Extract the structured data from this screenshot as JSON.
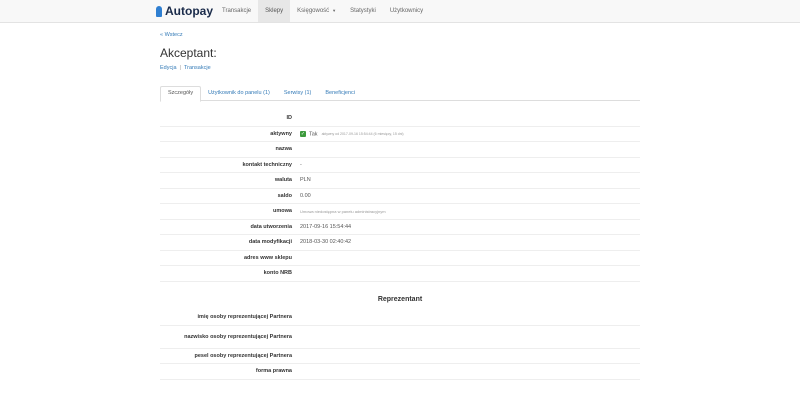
{
  "navbar": {
    "brand": "Autopay",
    "items": [
      {
        "label": "Transakcje"
      },
      {
        "label": "Sklepy"
      },
      {
        "label": "Księgowość"
      },
      {
        "label": "Statystyki"
      },
      {
        "label": "Użytkownicy"
      }
    ]
  },
  "back_link": "« Wstecz",
  "page_title": "Akceptant:",
  "sublinks": {
    "edit": "Edycja",
    "transactions": "Transakcje"
  },
  "tabs": [
    {
      "label": "Szczegóły"
    },
    {
      "label": "Użytkownik do panelu (1)"
    },
    {
      "label": "Serwisy (1)"
    },
    {
      "label": "Beneficjenci"
    }
  ],
  "details": {
    "id": {
      "label": "ID",
      "value": ""
    },
    "active": {
      "label": "aktywny",
      "value": "Tak",
      "since": "aktywny od 2017-09-16 15:54:44 (6 miesięcy, 15 dni)"
    },
    "name": {
      "label": "nazwa",
      "value": ""
    },
    "tech_contact": {
      "label": "kontakt techniczny",
      "value": "-"
    },
    "currency": {
      "label": "waluta",
      "value": "PLN"
    },
    "balance": {
      "label": "saldo",
      "value": "0.00"
    },
    "agreement": {
      "label": "umowa",
      "value": "Umowa niedostępna w panelu administracyjnym"
    },
    "created": {
      "label": "data utworzenia",
      "value": "2017-09-16 15:54:44"
    },
    "modified": {
      "label": "data modyfikacji",
      "value": "2018-03-30 02:40:42"
    },
    "www": {
      "label": "adres www sklepu",
      "value": ""
    },
    "nrb": {
      "label": "konto NRB",
      "value": ""
    }
  },
  "representative": {
    "title": "Reprezentant",
    "first_name": {
      "label": "imię osoby reprezentującej Partnera",
      "value": ""
    },
    "last_name": {
      "label": "nazwisko osoby reprezentującej Partnera",
      "value": ""
    },
    "pesel": {
      "label": "pesel osoby reprezentującej Partnera",
      "value": ""
    },
    "legal_form": {
      "label": "forma prawna",
      "value": ""
    }
  }
}
